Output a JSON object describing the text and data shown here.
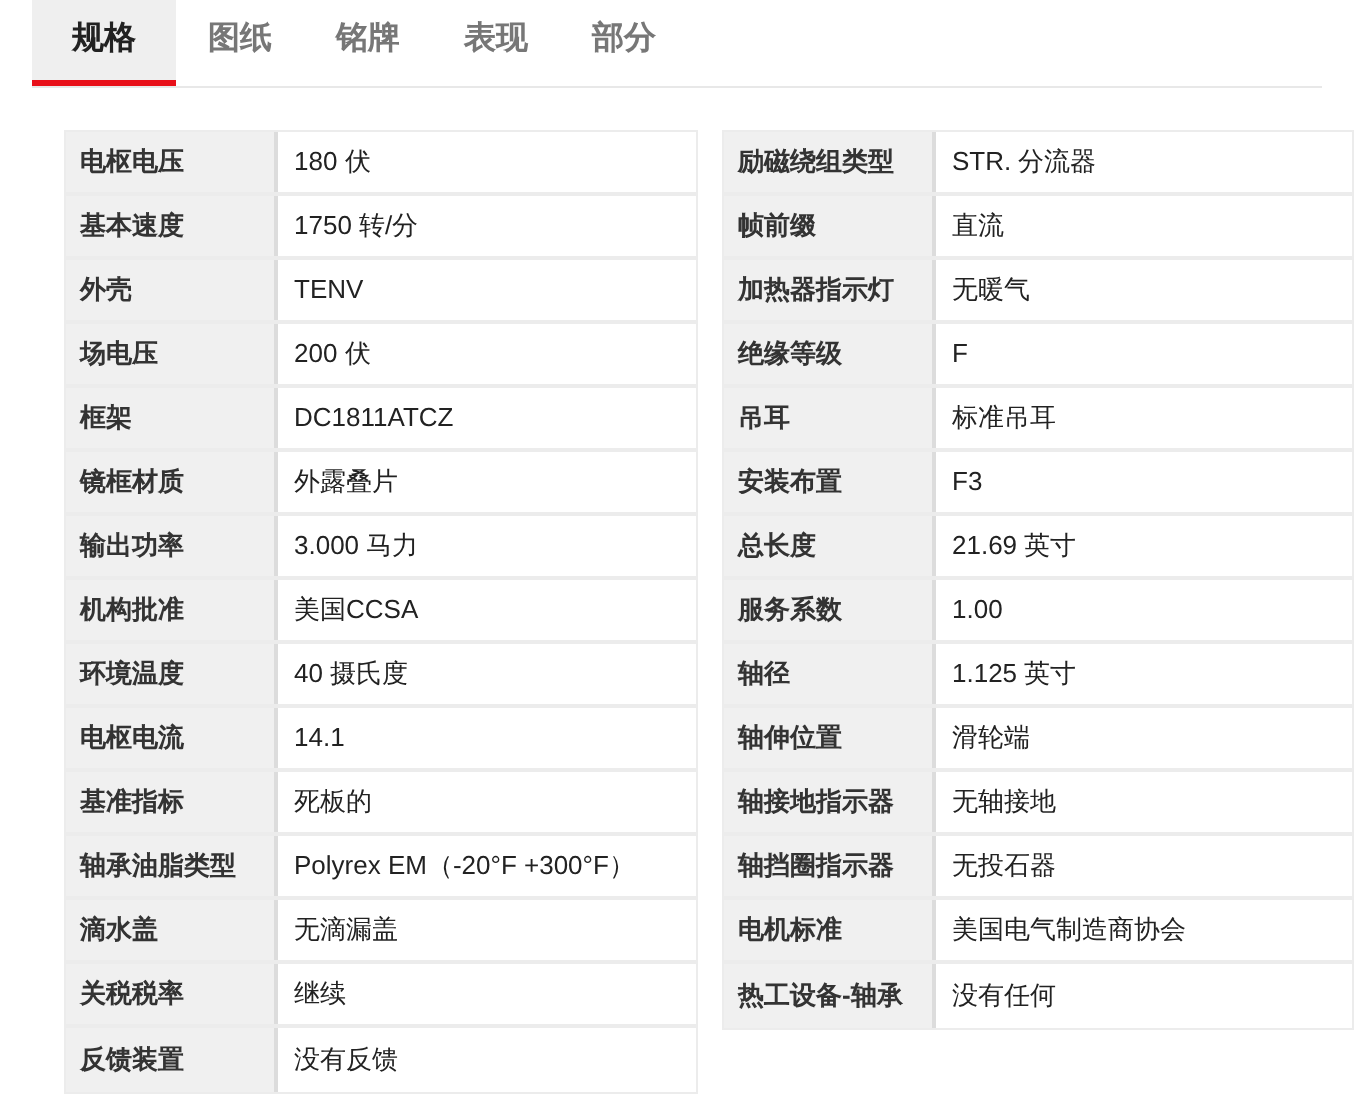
{
  "tabs": [
    {
      "label": "规格",
      "selected": true
    },
    {
      "label": "图纸",
      "selected": false
    },
    {
      "label": "铭牌",
      "selected": false
    },
    {
      "label": "表现",
      "selected": false
    },
    {
      "label": "部分",
      "selected": false
    }
  ],
  "spec_tables": [
    {
      "rows": [
        {
          "label": "电枢电压",
          "value": "180 伏"
        },
        {
          "label": "基本速度",
          "value": "1750 转/分"
        },
        {
          "label": "外壳",
          "value": "TENV"
        },
        {
          "label": "场电压",
          "value": "200 伏"
        },
        {
          "label": "框架",
          "value": "DC1811ATCZ"
        },
        {
          "label": "镜框材质",
          "value": "外露叠片"
        },
        {
          "label": "输出功率",
          "value": "3.000 马力"
        },
        {
          "label": "机构批准",
          "value": "美国CCSA"
        },
        {
          "label": "环境温度",
          "value": "40 摄氏度"
        },
        {
          "label": "电枢电流",
          "value": "14.1"
        },
        {
          "label": "基准指标",
          "value": "死板的"
        },
        {
          "label": "轴承油脂类型",
          "value": "Polyrex EM（-20°F +300°F）"
        },
        {
          "label": "滴水盖",
          "value": "无滴漏盖"
        },
        {
          "label": "关税税率",
          "value": "继续"
        },
        {
          "label": "反馈装置",
          "value": "没有反馈"
        }
      ]
    },
    {
      "rows": [
        {
          "label": "励磁绕组类型",
          "value": "STR. 分流器"
        },
        {
          "label": "帧前缀",
          "value": "直流"
        },
        {
          "label": "加热器指示灯",
          "value": "无暖气"
        },
        {
          "label": "绝缘等级",
          "value": "F"
        },
        {
          "label": "吊耳",
          "value": "标准吊耳"
        },
        {
          "label": "安装布置",
          "value": "F3"
        },
        {
          "label": "总长度",
          "value": "21.69 英寸"
        },
        {
          "label": "服务系数",
          "value": "1.00"
        },
        {
          "label": "轴径",
          "value": "1.125 英寸"
        },
        {
          "label": "轴伸位置",
          "value": "滑轮端"
        },
        {
          "label": "轴接地指示器",
          "value": "无轴接地"
        },
        {
          "label": "轴挡圈指示器",
          "value": "无投石器"
        },
        {
          "label": "电机标准",
          "value": "美国电气制造商协会"
        },
        {
          "label": "热工设备-轴承",
          "value": "没有任何"
        }
      ]
    }
  ]
}
